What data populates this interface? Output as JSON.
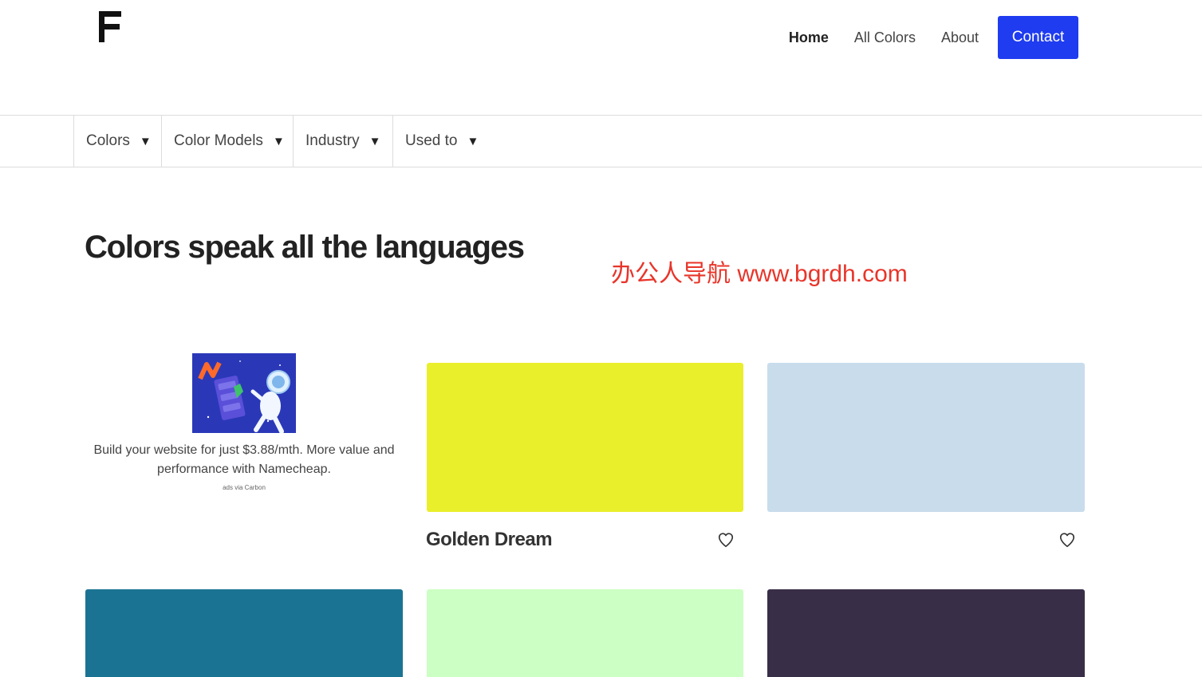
{
  "nav": {
    "items": [
      {
        "label": "Home"
      },
      {
        "label": "All Colors"
      },
      {
        "label": "About"
      }
    ],
    "contact_label": "Contact"
  },
  "subnav": {
    "items": [
      {
        "label": "Colors"
      },
      {
        "label": "Color Models"
      },
      {
        "label": "Industry"
      },
      {
        "label": "Used to"
      }
    ]
  },
  "hero": {
    "title": "Colors speak all the languages"
  },
  "watermark": "办公人导航  www.bgrdh.com",
  "ad": {
    "text": "Build your website for just $3.88/mth. More value and performance with Namecheap.",
    "via": "ads via Carbon"
  },
  "cards": [
    {
      "name": "Golden Dream",
      "color": "#eaef2c"
    },
    {
      "name": "",
      "color": "#c8dcec"
    },
    {
      "name": "",
      "color": "#1b7394"
    },
    {
      "name": "",
      "color": "#ccffc3"
    },
    {
      "name": "",
      "color": "#392e48"
    }
  ],
  "colors": {
    "accent": "#1f3cf0",
    "watermark": "#e8352a"
  }
}
